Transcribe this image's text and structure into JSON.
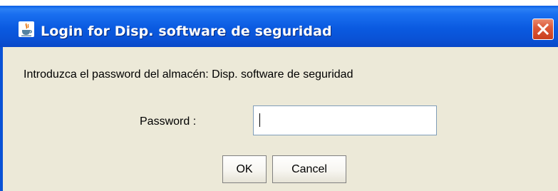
{
  "window": {
    "title": "Login for Disp. software de seguridad",
    "app_icon": "java-cup-icon",
    "close_icon": "close-icon"
  },
  "dialog": {
    "message": "Introduzca el password del  almacén: Disp. software de seguridad",
    "password_label": "Password :",
    "password_value": "",
    "ok_label": "OK",
    "cancel_label": "Cancel"
  },
  "colors": {
    "titlebar": "#0a52d6",
    "close_button": "#dd5a3a",
    "client_background": "#ece9d8"
  }
}
